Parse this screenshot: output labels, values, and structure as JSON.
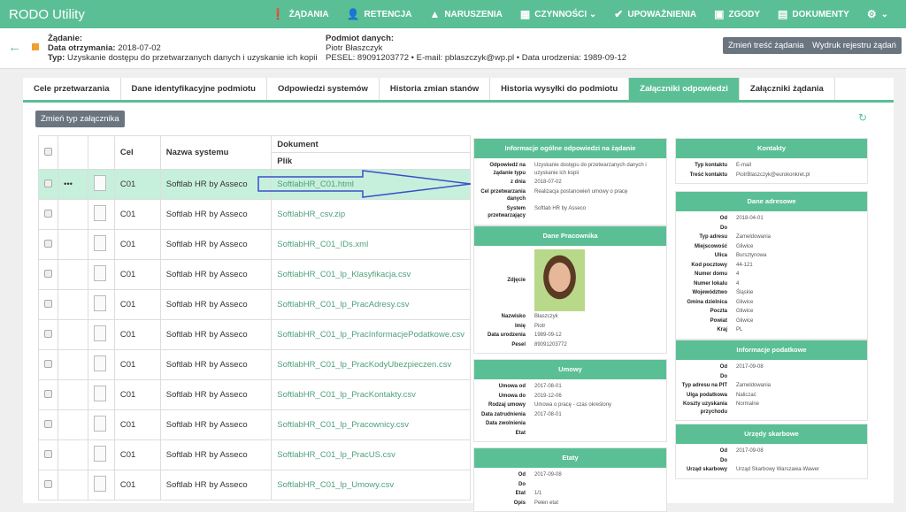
{
  "app": {
    "title": "RODO Utility"
  },
  "nav": [
    {
      "icon": "exclamation-icon",
      "label": "ŻĄDANIA"
    },
    {
      "icon": "archive-user-icon",
      "label": "RETENCJA"
    },
    {
      "icon": "warning-icon",
      "label": "NARUSZENIA"
    },
    {
      "icon": "calendar-icon",
      "label": "CZYNNOŚCI ⌄"
    },
    {
      "icon": "shield-check-icon",
      "label": "UPOWAŻNIENIA"
    },
    {
      "icon": "consent-icon",
      "label": "ZGODY"
    },
    {
      "icon": "document-icon",
      "label": "DOKUMENTY"
    },
    {
      "icon": "gear-icon",
      "label": "⌄"
    }
  ],
  "request": {
    "title": "Żądanie:",
    "date_label": "Data otrzymania:",
    "date": "2018-07-02",
    "type_label": "Typ:",
    "type": "Uzyskanie dostępu do przetwarzanych danych i uzyskanie ich kopii"
  },
  "subject": {
    "title": "Podmiot danych:",
    "name": "Piotr Błaszczyk",
    "details": "PESEL: 89091203772 • E-mail: pblaszczyk@wp.pl • Data urodzenia: 1989-09-12"
  },
  "actions": {
    "edit": "Zmień treść żądania",
    "print": "Wydruk rejestru żądań",
    "change_type": "Zmień typ załącznika"
  },
  "tabs": [
    "Cele przetwarzania",
    "Dane identyfikacyjne podmiotu",
    "Odpowiedzi systemów",
    "Historia zmian stanów",
    "Historia wysyłki do podmiotu",
    "Załączniki odpowiedzi",
    "Załączniki żądania"
  ],
  "active_tab": 5,
  "table": {
    "headers": {
      "cel": "Cel",
      "system": "Nazwa systemu",
      "doc": "Dokument",
      "file": "Plik"
    },
    "rows": [
      {
        "cel": "C01",
        "system": "Softlab HR by Asseco",
        "file": "SoftlabHR_C01.html",
        "selected": true
      },
      {
        "cel": "C01",
        "system": "Softlab HR by Asseco",
        "file": "SoftlabHR_csv.zip"
      },
      {
        "cel": "C01",
        "system": "Softlab HR by Asseco",
        "file": "SoftlabHR_C01_IDs.xml"
      },
      {
        "cel": "C01",
        "system": "Softlab HR by Asseco",
        "file": "SoftlabHR_C01_lp_Klasyfikacja.csv"
      },
      {
        "cel": "C01",
        "system": "Softlab HR by Asseco",
        "file": "SoftlabHR_C01_lp_PracAdresy.csv"
      },
      {
        "cel": "C01",
        "system": "Softlab HR by Asseco",
        "file": "SoftlabHR_C01_lp_PracInformacjePodatkowe.csv"
      },
      {
        "cel": "C01",
        "system": "Softlab HR by Asseco",
        "file": "SoftlabHR_C01_lp_PracKodyUbezpieczen.csv"
      },
      {
        "cel": "C01",
        "system": "Softlab HR by Asseco",
        "file": "SoftlabHR_C01_lp_PracKontakty.csv"
      },
      {
        "cel": "C01",
        "system": "Softlab HR by Asseco",
        "file": "SoftlabHR_C01_lp_Pracownicy.csv"
      },
      {
        "cel": "C01",
        "system": "Softlab HR by Asseco",
        "file": "SoftlabHR_C01_lp_PracUS.csv"
      },
      {
        "cel": "C01",
        "system": "Softlab HR by Asseco",
        "file": "SoftlabHR_C01_lp_Umowy.csv"
      }
    ]
  },
  "cards": [
    {
      "title": "Informacje ogólne odpowiedzi na żądanie",
      "rows": [
        [
          "Odpowiedź na żądanie typu",
          "Uzyskanie dostępu do przetwarzanych danych i uzyskanie ich kopii"
        ],
        [
          "z dnia",
          "2018-07-02"
        ],
        [
          "Cel przetwarzania danych",
          "Realizacja postanowień umowy o pracę"
        ],
        [
          "System przetwarzający",
          "Softlab HR by Asseco"
        ]
      ]
    },
    {
      "title": "Dane Pracownika",
      "photo_label": "Zdjęcie",
      "rows": [
        [
          "Nazwisko",
          "Błaszczyk"
        ],
        [
          "Imię",
          "Piotr"
        ],
        [
          "Data urodzenia",
          "1989-09-12"
        ],
        [
          "Pesel",
          "89091203772"
        ]
      ]
    },
    {
      "title": "Umowy",
      "rows": [
        [
          "Umowa od",
          "2017-08-01"
        ],
        [
          "Umowa do",
          "2019-12-06"
        ],
        [
          "Rodzaj umowy",
          "Umowa o pracę - czas określony"
        ],
        [
          "Data zatrudnienia",
          "2017-08-01"
        ],
        [
          "Data zwolnienia",
          ""
        ],
        [
          "Etat",
          ""
        ]
      ]
    },
    {
      "title": "Etaty",
      "rows": [
        [
          "Od",
          "2017-09-08"
        ],
        [
          "Do",
          ""
        ],
        [
          "Etat",
          "1/1"
        ],
        [
          "Opis",
          "Pełen etat"
        ]
      ]
    },
    {
      "title": "Kontakty",
      "rows": [
        [
          "Typ kontaktu",
          "E-mail"
        ],
        [
          "Treść kontaktu",
          "PiotrBlaszczyk@eurokonkret.pl"
        ]
      ]
    },
    {
      "title": "Dane adresowe",
      "rows": [
        [
          "Od",
          "2018-04-01"
        ],
        [
          "Do",
          ""
        ],
        [
          "Typ adresu",
          "Zameldowania"
        ],
        [
          "Miejscowość",
          "Gliwice"
        ],
        [
          "Ulica",
          "Bursztynowa"
        ],
        [
          "Kod pocztowy",
          "44-121"
        ],
        [
          "Numer domu",
          "4"
        ],
        [
          "Numer lokalu",
          "4"
        ],
        [
          "Województwo",
          "Śląskie"
        ],
        [
          "Gmina dzielnica",
          "Gliwice"
        ],
        [
          "Poczta",
          "Gliwice"
        ],
        [
          "Powiat",
          "Gliwice"
        ],
        [
          "Kraj",
          "PL"
        ]
      ]
    },
    {
      "title": "Informacje podatkowe",
      "rows": [
        [
          "Od",
          "2017-09-08"
        ],
        [
          "Do",
          ""
        ],
        [
          "Typ adresu na PIT",
          "Zameldowania"
        ],
        [
          "Ulga podatkowa",
          "Naliczać"
        ],
        [
          "Koszty uzyskania przychodu",
          "Normalne"
        ]
      ]
    },
    {
      "title": "Urzędy skarbowe",
      "rows": [
        [
          "Od",
          "2017-09-08"
        ],
        [
          "Do",
          ""
        ],
        [
          "Urząd skarbowy",
          "Urząd Skarbowy Warszawa-Wawer"
        ]
      ]
    }
  ],
  "colors": {
    "accent": "#5bbf95",
    "selected_row": "#c7f0dc",
    "arrow": "#3a4fc8"
  }
}
